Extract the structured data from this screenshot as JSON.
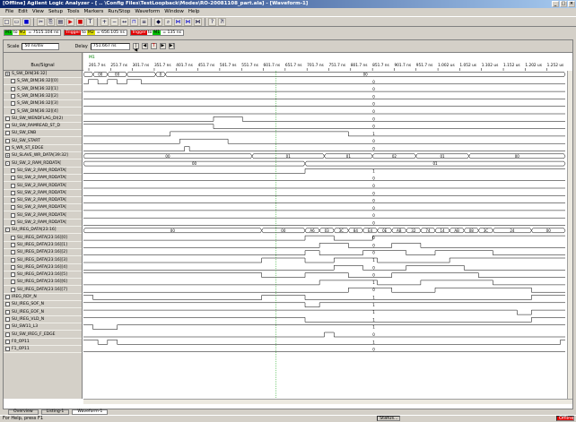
{
  "window": {
    "title": "[Offline] Agilent Logic Analyzer - [ .. \\Config Files\\TestLoopback\\Modes\\RO-20081108_part.ala] - [Waveform-1]",
    "buttons": [
      "_",
      "□",
      "×"
    ]
  },
  "menu": [
    "File",
    "Edit",
    "View",
    "Setup",
    "Tools",
    "Markers",
    "Run/Stop",
    "Waveform",
    "Window",
    "Help"
  ],
  "markers": [
    {
      "from": "M1",
      "to": "M2",
      "value": "= 7515.104 ns",
      "c1": "#00c000",
      "c2": "#e0e000"
    },
    {
      "from": "Trigger",
      "to": "M2",
      "value": "= 656.105 ns",
      "c1": "#e00000",
      "c2": "#e0e000"
    },
    {
      "from": "Trigger",
      "to": "M1",
      "value": "= 135 ns",
      "c1": "#e00000",
      "c2": "#00c000"
    }
  ],
  "controls": {
    "scale_label": "Scale",
    "scale_value": "50 ns/div",
    "delay_label": "Delay",
    "delay_value": "751.667 ns"
  },
  "header": {
    "bus_signal": "Bus/Signal",
    "marker_m1": "M1",
    "ticks": [
      "201.7 ns",
      "251.7 ns",
      "301.7 ns",
      "351.7 ns",
      "401.7 ns",
      "451.7 ns",
      "501.7 ns",
      "551.7 ns",
      "601.7 ns",
      "651.7 ns",
      "701.7 ns",
      "751.7 ns",
      "801.7 ns",
      "851.7 ns",
      "901.7 ns",
      "951.7 ns",
      "1.002 us",
      "1.052 us",
      "1.102 us",
      "1.152 us",
      "1.202 us",
      "1.252 us"
    ]
  },
  "signals": [
    {
      "name": "S_SW_DIN[36:32]",
      "expand": "+",
      "bus": true,
      "indent": 0
    },
    {
      "name": "S_SW_DIN[36:32][0]",
      "indent": 1
    },
    {
      "name": "S_SW_DIN[36:32][1]",
      "indent": 1
    },
    {
      "name": "S_SW_DIN[36:32][2]",
      "indent": 1
    },
    {
      "name": "S_SW_DIN[36:32][3]",
      "indent": 1
    },
    {
      "name": "S_SW_DIN[36:32][4]",
      "indent": 1
    },
    {
      "name": "SU_SW_WENDFLAG_DI(2)",
      "indent": 0
    },
    {
      "name": "SU_SW_RAMREAD_ST_D",
      "indent": 0
    },
    {
      "name": "SU_SW_ENB",
      "indent": 0
    },
    {
      "name": "SU_SW_START",
      "indent": 0
    },
    {
      "name": "S_WR_ST_EDGE",
      "indent": 0
    },
    {
      "name": "SU_SLAVE_WR_DATA[39:32]",
      "expand": "+",
      "bus": true,
      "indent": 0
    },
    {
      "name": "SU_SW_2_RAM_RDDATA[",
      "expand": "-",
      "bus": true,
      "indent": 0
    },
    {
      "name": "SU_SW_2_RAM_RDDATA[",
      "indent": 1
    },
    {
      "name": "SU_SW_2_RAM_RDDATA[",
      "indent": 1
    },
    {
      "name": "SU_SW_2_RAM_RDDATA[",
      "indent": 1
    },
    {
      "name": "SU_SW_2_RAM_RDDATA[",
      "indent": 1
    },
    {
      "name": "SU_SW_2_RAM_RDDATA[",
      "indent": 1
    },
    {
      "name": "SU_SW_2_RAM_RDDATA[",
      "indent": 1
    },
    {
      "name": "SU_SW_2_RAM_RDDATA[",
      "indent": 1
    },
    {
      "name": "SU_SW_2_RAM_RDDATA[",
      "indent": 1
    },
    {
      "name": "SU_IREG_DATA[23:16]",
      "expand": "-",
      "bus": true,
      "indent": 0
    },
    {
      "name": "SU_IREG_DATA[23:16][0]",
      "indent": 1
    },
    {
      "name": "SU_IREG_DATA[23:16][1]",
      "indent": 1
    },
    {
      "name": "SU_IREG_DATA[23:16][2]",
      "indent": 1
    },
    {
      "name": "SU_IREG_DATA[23:16][3]",
      "indent": 1
    },
    {
      "name": "SU_IREG_DATA[23:16][4]",
      "indent": 1
    },
    {
      "name": "SU_IREG_DATA[23:16][5]",
      "indent": 1
    },
    {
      "name": "SU_IREG_DATA[23:16][6]",
      "indent": 1
    },
    {
      "name": "SU_IREG_DATA[23:16][7]",
      "indent": 1
    },
    {
      "name": "IREG_RDY_N",
      "indent": 0
    },
    {
      "name": "SU_IREG_SOF_N",
      "indent": 0
    },
    {
      "name": "SU_IREG_EOF_N",
      "indent": 0
    },
    {
      "name": "SU_IREG_VLD_N",
      "indent": 0
    },
    {
      "name": "SU_SW11_L3",
      "indent": 0
    },
    {
      "name": "SU_SW_IREG_F_EDGE",
      "indent": 0
    },
    {
      "name": "F0_OP11",
      "indent": 0
    },
    {
      "name": "F1_OP11",
      "indent": 0
    }
  ],
  "waves": [
    {
      "type": "bus",
      "segs": [
        [
          0,
          0.02,
          ""
        ],
        [
          0.02,
          0.05,
          "00"
        ],
        [
          0.05,
          0.09,
          "00"
        ],
        [
          0.09,
          0.15,
          ""
        ],
        [
          0.15,
          0.17,
          "0"
        ],
        [
          0.17,
          1,
          "00"
        ]
      ]
    },
    {
      "type": "bit",
      "pts": [
        [
          0,
          0
        ],
        [
          0.01,
          1
        ],
        [
          0.03,
          0
        ],
        [
          0.05,
          1
        ],
        [
          0.07,
          0
        ],
        [
          0.09,
          1
        ],
        [
          0.12,
          0
        ]
      ],
      "label": "0"
    },
    {
      "type": "bit",
      "pts": [
        [
          0,
          0
        ]
      ],
      "label": "0"
    },
    {
      "type": "bit",
      "pts": [
        [
          0,
          0
        ]
      ],
      "label": "0"
    },
    {
      "type": "bit",
      "pts": [
        [
          0,
          0
        ]
      ],
      "label": "0"
    },
    {
      "type": "bit",
      "pts": [
        [
          0,
          0
        ]
      ],
      "label": "0"
    },
    {
      "type": "bit",
      "pts": [
        [
          0,
          0
        ],
        [
          0.27,
          1
        ],
        [
          0.33,
          0
        ]
      ],
      "label": "0"
    },
    {
      "type": "bit",
      "pts": [
        [
          0,
          1
        ],
        [
          0.27,
          0
        ]
      ],
      "label": "0"
    },
    {
      "type": "bit",
      "pts": [
        [
          0,
          0
        ],
        [
          0.18,
          1
        ],
        [
          0.55,
          0
        ]
      ],
      "label": "1"
    },
    {
      "type": "bit",
      "pts": [
        [
          0,
          0
        ],
        [
          0.2,
          1
        ],
        [
          0.3,
          0
        ]
      ],
      "label": "0"
    },
    {
      "type": "bit",
      "pts": [
        [
          0,
          0
        ],
        [
          0.21,
          1
        ],
        [
          0.22,
          0
        ]
      ],
      "label": "0"
    },
    {
      "type": "bus",
      "segs": [
        [
          0,
          0.35,
          "00"
        ],
        [
          0.35,
          0.5,
          "01"
        ],
        [
          0.5,
          0.6,
          "01"
        ],
        [
          0.6,
          0.69,
          "02"
        ],
        [
          0.69,
          0.8,
          "01"
        ],
        [
          0.8,
          1,
          "00"
        ]
      ]
    },
    {
      "type": "bus",
      "segs": [
        [
          0,
          0.46,
          "00"
        ],
        [
          0.46,
          1,
          "01"
        ]
      ]
    },
    {
      "type": "bit",
      "pts": [
        [
          0,
          0
        ],
        [
          0.46,
          1
        ]
      ],
      "label": "1"
    },
    {
      "type": "bit",
      "pts": [
        [
          0,
          0
        ]
      ],
      "label": "0"
    },
    {
      "type": "bit",
      "pts": [
        [
          0,
          0
        ]
      ],
      "label": "0"
    },
    {
      "type": "bit",
      "pts": [
        [
          0,
          0
        ]
      ],
      "label": "0"
    },
    {
      "type": "bit",
      "pts": [
        [
          0,
          0
        ]
      ],
      "label": "0"
    },
    {
      "type": "bit",
      "pts": [
        [
          0,
          0
        ]
      ],
      "label": "0"
    },
    {
      "type": "bit",
      "pts": [
        [
          0,
          0
        ]
      ],
      "label": "0"
    },
    {
      "type": "bit",
      "pts": [
        [
          0,
          0
        ]
      ],
      "label": "0"
    },
    {
      "type": "bus",
      "segs": [
        [
          0,
          0.37,
          "00"
        ],
        [
          0.37,
          0.46,
          "00"
        ],
        [
          0.46,
          0.49,
          "A6"
        ],
        [
          0.49,
          0.52,
          "03"
        ],
        [
          0.52,
          0.55,
          "3C"
        ],
        [
          0.55,
          0.58,
          "84"
        ],
        [
          0.58,
          0.61,
          "E4"
        ],
        [
          0.61,
          0.64,
          "0E"
        ],
        [
          0.64,
          0.67,
          "AB"
        ],
        [
          0.67,
          0.7,
          "32"
        ],
        [
          0.7,
          0.73,
          "74"
        ],
        [
          0.73,
          0.76,
          "14"
        ],
        [
          0.76,
          0.79,
          "AB"
        ],
        [
          0.79,
          0.82,
          "08"
        ],
        [
          0.82,
          0.85,
          "3C"
        ],
        [
          0.85,
          0.93,
          "24"
        ],
        [
          0.93,
          1,
          "00"
        ]
      ]
    },
    {
      "type": "bit",
      "pts": [
        [
          0,
          0
        ],
        [
          0.46,
          1
        ],
        [
          0.52,
          0
        ],
        [
          0.6,
          1
        ]
      ],
      "label": "0"
    },
    {
      "type": "bit",
      "pts": [
        [
          0,
          0
        ],
        [
          0.49,
          1
        ],
        [
          0.55,
          0
        ],
        [
          0.64,
          1
        ],
        [
          0.7,
          0
        ]
      ],
      "label": "0"
    },
    {
      "type": "bit",
      "pts": [
        [
          0,
          0
        ],
        [
          0.46,
          1
        ],
        [
          0.49,
          0
        ],
        [
          0.58,
          1
        ],
        [
          0.67,
          0
        ],
        [
          0.73,
          1
        ],
        [
          0.85,
          0
        ]
      ],
      "label": "0"
    },
    {
      "type": "bit",
      "pts": [
        [
          0,
          0
        ],
        [
          0.37,
          1
        ],
        [
          0.46,
          0
        ],
        [
          0.52,
          1
        ],
        [
          0.61,
          0
        ],
        [
          0.76,
          1
        ]
      ],
      "label": "1"
    },
    {
      "type": "bit",
      "pts": [
        [
          0,
          0
        ],
        [
          0.52,
          1
        ],
        [
          0.58,
          0
        ],
        [
          0.67,
          1
        ],
        [
          0.79,
          0
        ]
      ],
      "label": "0"
    },
    {
      "type": "bit",
      "pts": [
        [
          0,
          1
        ],
        [
          0.37,
          0
        ],
        [
          0.46,
          1
        ],
        [
          0.55,
          0
        ],
        [
          0.64,
          1
        ],
        [
          0.82,
          0
        ]
      ],
      "label": "0"
    },
    {
      "type": "bit",
      "pts": [
        [
          0,
          0
        ],
        [
          0.49,
          1
        ],
        [
          0.61,
          0
        ],
        [
          0.7,
          1
        ],
        [
          0.85,
          0
        ]
      ],
      "label": "1"
    },
    {
      "type": "bit",
      "pts": [
        [
          0,
          0
        ],
        [
          0.55,
          1
        ],
        [
          0.64,
          0
        ],
        [
          0.73,
          1
        ],
        [
          0.93,
          0
        ]
      ],
      "label": "0"
    },
    {
      "type": "bit",
      "pts": [
        [
          0,
          1
        ],
        [
          0.02,
          0
        ],
        [
          0.37,
          1
        ],
        [
          0.46,
          0
        ],
        [
          0.93,
          1
        ]
      ],
      "label": "1"
    },
    {
      "type": "bit",
      "pts": [
        [
          0,
          1
        ],
        [
          0.46,
          0
        ],
        [
          0.49,
          1
        ]
      ],
      "label": "1"
    },
    {
      "type": "bit",
      "pts": [
        [
          0,
          1
        ],
        [
          0.9,
          0
        ],
        [
          0.93,
          1
        ]
      ],
      "label": "1"
    },
    {
      "type": "bit",
      "pts": [
        [
          0,
          1
        ],
        [
          0.46,
          0
        ],
        [
          0.93,
          1
        ]
      ],
      "label": "1"
    },
    {
      "type": "bit",
      "pts": [
        [
          0,
          1
        ],
        [
          0.02,
          0
        ],
        [
          0.07,
          1
        ]
      ],
      "label": "1"
    },
    {
      "type": "bit",
      "pts": [
        [
          0,
          0
        ],
        [
          0.5,
          1
        ],
        [
          0.52,
          0
        ]
      ],
      "label": "0"
    },
    {
      "type": "bit",
      "pts": [
        [
          0,
          1
        ],
        [
          0.03,
          0
        ],
        [
          0.05,
          1
        ],
        [
          0.07,
          0
        ],
        [
          0.99,
          1
        ]
      ],
      "label": "1"
    },
    {
      "type": "bit",
      "pts": [
        [
          0,
          0
        ]
      ],
      "label": "0"
    }
  ],
  "tabs": [
    "Overview",
    "Listing-1",
    "Waveform-1"
  ],
  "status": {
    "left": "For Help, press F1",
    "status_btn": "Status...",
    "offline": "Offline"
  }
}
